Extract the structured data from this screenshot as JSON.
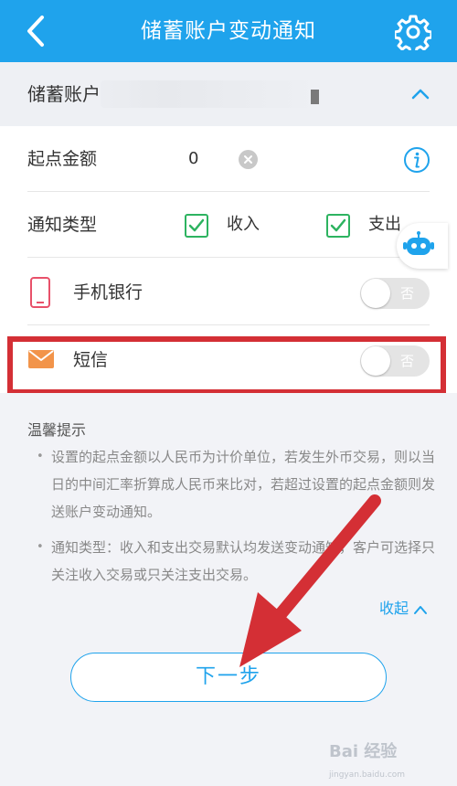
{
  "header": {
    "title": "储蓄账户变动通知",
    "back_icon": "chevron-left-icon",
    "settings_icon": "gear-icon",
    "color": "#1fa3ec"
  },
  "account": {
    "label": "储蓄账户",
    "expand_icon": "chevron-up-icon"
  },
  "form": {
    "threshold_label": "起点金额",
    "threshold_value": "0",
    "notice_type_label": "通知类型",
    "income_label": "收入",
    "income_checked": true,
    "expense_label": "支出",
    "expense_checked": true,
    "mobile_bank_label": "手机银行",
    "mobile_bank_toggle": "否",
    "sms_label": "短信",
    "sms_toggle": "否"
  },
  "tips": {
    "title": "温馨提示",
    "items": [
      "设置的起点金额以人民币为计价单位，若发生外币交易，则以当日的中间汇率折算成人民币来比对，若超过设置的起点金额则发送账户变动通知。",
      "通知类型：收入和支出交易默认均发送变动通知，客户可选择只关注收入交易或只关注支出交易。"
    ],
    "collapse_label": "收起"
  },
  "next_button": "下一步",
  "annotation": {
    "highlight_color": "#d42f35"
  },
  "watermark": {
    "text": "Bai 经验",
    "sub": "jingyan.baidu.com"
  }
}
